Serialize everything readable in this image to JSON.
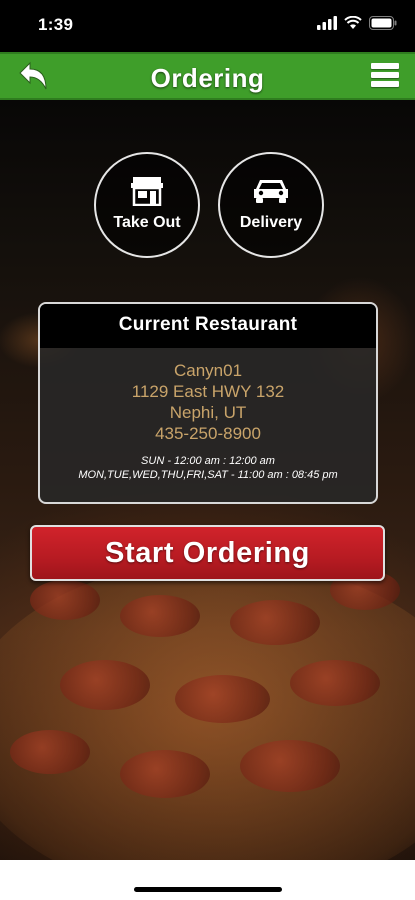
{
  "status_bar": {
    "time": "1:39"
  },
  "header": {
    "title": "Ordering",
    "back_icon": "back-arrow-icon",
    "menu_icon": "hamburger-menu-icon",
    "accent_color": "#3f9e2a"
  },
  "order_types": [
    {
      "label": "Take Out",
      "icon": "storefront-icon"
    },
    {
      "label": "Delivery",
      "icon": "car-icon"
    }
  ],
  "restaurant": {
    "heading": "Current Restaurant",
    "name": "Canyn01",
    "address": "1129 East HWY 132",
    "city": "Nephi, UT",
    "phone": "435-250-8900",
    "hours": [
      "SUN - 12:00 am : 12:00 am",
      "MON,TUE,WED,THU,FRI,SAT - 11:00 am : 08:45 pm"
    ],
    "text_color": "#c9a46a"
  },
  "start_button": {
    "label": "Start Ordering",
    "color": "#c21e26"
  }
}
